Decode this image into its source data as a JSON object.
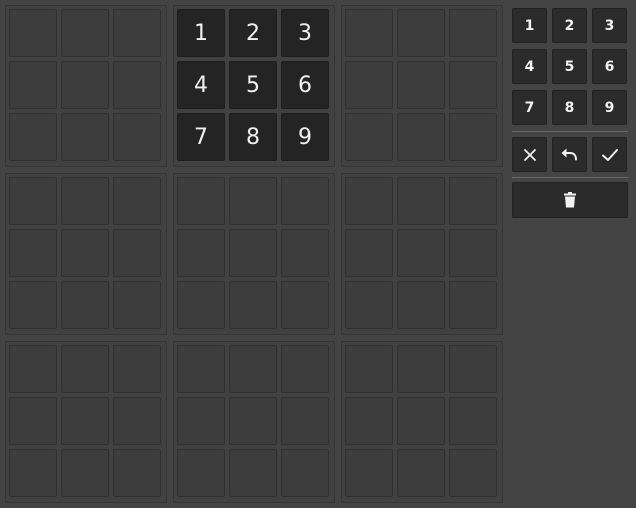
{
  "board": {
    "rows": [
      [
        "",
        "",
        "",
        "1",
        "2",
        "3",
        "",
        "",
        ""
      ],
      [
        "",
        "",
        "",
        "4",
        "5",
        "6",
        "",
        "",
        ""
      ],
      [
        "",
        "",
        "",
        "7",
        "8",
        "9",
        "",
        "",
        ""
      ],
      [
        "",
        "",
        "",
        "",
        "",
        "",
        "",
        "",
        ""
      ],
      [
        "",
        "",
        "",
        "",
        "",
        "",
        "",
        "",
        ""
      ],
      [
        "",
        "",
        "",
        "",
        "",
        "",
        "",
        "",
        ""
      ],
      [
        "",
        "",
        "",
        "",
        "",
        "",
        "",
        "",
        ""
      ],
      [
        "",
        "",
        "",
        "",
        "",
        "",
        "",
        "",
        ""
      ],
      [
        "",
        "",
        "",
        "",
        "",
        "",
        "",
        "",
        ""
      ]
    ]
  },
  "keypad": {
    "digits": [
      "1",
      "2",
      "3",
      "4",
      "5",
      "6",
      "7",
      "8",
      "9"
    ]
  },
  "actions": {
    "clear_icon": "close-icon",
    "undo_icon": "undo-icon",
    "confirm_icon": "check-icon",
    "delete_icon": "trash-icon"
  },
  "colors": {
    "background": "#444444",
    "cell_empty": "#3d3d3d",
    "cell_filled": "#242424",
    "button": "#2b2b2b",
    "text": "#f0f0f0"
  }
}
